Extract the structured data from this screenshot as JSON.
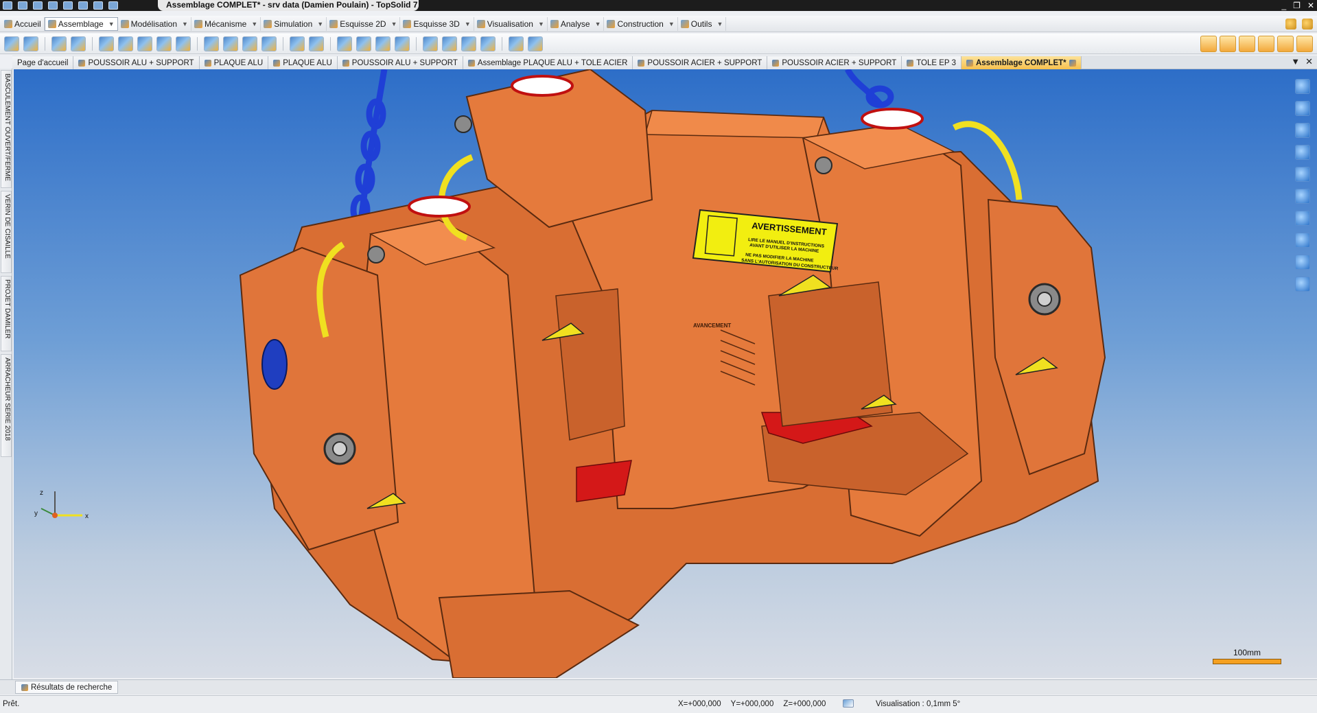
{
  "window": {
    "title": "Assemblage COMPLET* - srv data (Damien Poulain) - TopSolid 7",
    "controls": [
      "_",
      "❐",
      "✕"
    ]
  },
  "menu": {
    "items": [
      {
        "label": "Accueil",
        "icon": "home-icon",
        "active": false
      },
      {
        "label": "Assemblage",
        "icon": "assembly-icon",
        "active": true
      },
      {
        "label": "Modélisation",
        "icon": "modeling-icon",
        "active": false
      },
      {
        "label": "Mécanisme",
        "icon": "mechanism-icon",
        "active": false
      },
      {
        "label": "Simulation",
        "icon": "simulation-icon",
        "active": false
      },
      {
        "label": "Esquisse 2D",
        "icon": "sketch2d-icon",
        "active": false
      },
      {
        "label": "Esquisse 3D",
        "icon": "sketch3d-icon",
        "active": false
      },
      {
        "label": "Visualisation",
        "icon": "visualization-icon",
        "active": false
      },
      {
        "label": "Analyse",
        "icon": "analysis-icon",
        "active": false
      },
      {
        "label": "Construction",
        "icon": "construction-icon",
        "active": false
      },
      {
        "label": "Outils",
        "icon": "tools-icon",
        "active": false
      }
    ]
  },
  "tabs": [
    {
      "label": "Page d'accueil",
      "active": false
    },
    {
      "label": "POUSSOIR ALU + SUPPORT",
      "active": false
    },
    {
      "label": "PLAQUE ALU",
      "active": false
    },
    {
      "label": "PLAQUE ALU",
      "active": false
    },
    {
      "label": "POUSSOIR ALU + SUPPORT",
      "active": false
    },
    {
      "label": "Assemblage PLAQUE ALU + TOLE ACIER",
      "active": false
    },
    {
      "label": "POUSSOIR ACIER + SUPPORT",
      "active": false
    },
    {
      "label": "POUSSOIR ACIER + SUPPORT",
      "active": false
    },
    {
      "label": "TOLE EP 3",
      "active": false
    },
    {
      "label": "Assemblage COMPLET*",
      "active": true
    }
  ],
  "side_panels": [
    "BASCULEMENT OUVERT/FERME",
    "VERIN DE CISAILLE",
    "PROJET DAMILER",
    "ARRACHEUR SERIE 2018"
  ],
  "viewport": {
    "label_warning": "AVERTISSEMENT",
    "label_line1": "LIRE LE MANUEL D'INSTRUCTIONS",
    "label_line2": "AVANT D'UTILISER LA MACHINE",
    "label_line3": "NE PAS MODIFIER LA MACHINE",
    "label_line4": "SANS L'AUTORISATION DU CONSTRUCTEUR",
    "engraving": "AVANCEMENT",
    "axis_x": "x",
    "axis_y": "y",
    "axis_z": "z",
    "scale": "100mm"
  },
  "bottom_panel": {
    "search_tab": "Résultats de recherche"
  },
  "status": {
    "ready": "Prêt.",
    "x": "X=+000,000",
    "y": "Y=+000,000",
    "z": "Z=+000,000",
    "visualisation": "Visualisation : 0,1mm 5°"
  },
  "colors": {
    "part_orange": "#e57a3c",
    "part_shadow": "#b85a26",
    "chain_blue": "#1f3fd6",
    "handle_yellow": "#f0e020",
    "pad_red": "#d41818",
    "active_tab": "#f6c04e"
  }
}
